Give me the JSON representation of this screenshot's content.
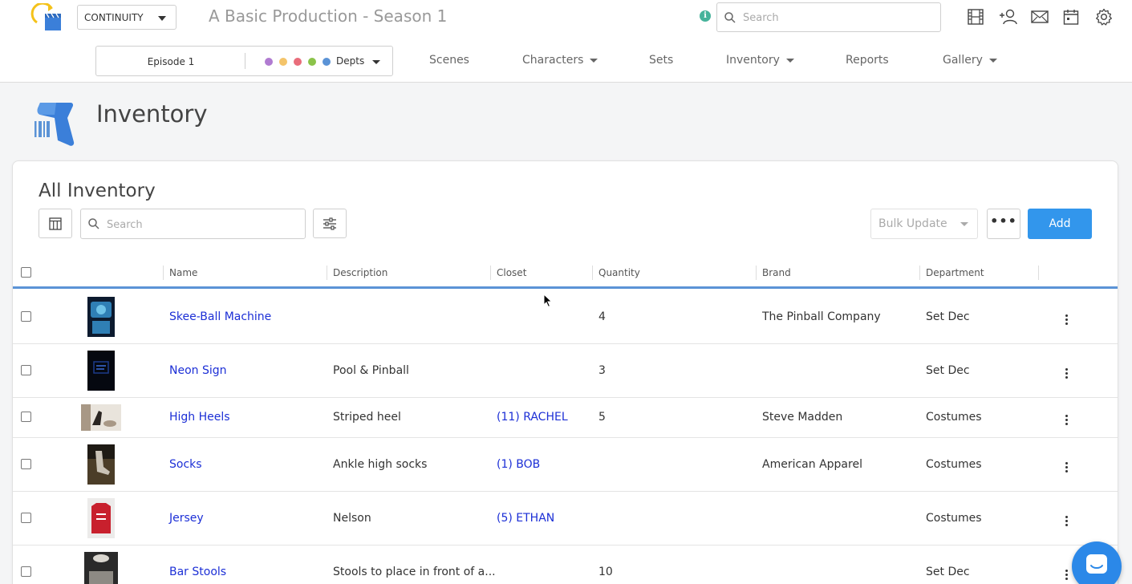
{
  "header": {
    "app_select": "CONTINUITY",
    "production_title": "A Basic Production - Season 1",
    "info_icon": "info-icon",
    "search_placeholder": "Search",
    "icons": [
      "film-icon",
      "add-user-icon",
      "mail-icon",
      "calendar-icon",
      "gear-icon"
    ]
  },
  "subnav": {
    "episode": "Episode 1",
    "dept_colors": [
      "#b07bd1",
      "#f4c46a",
      "#e96d7b",
      "#8bc34a",
      "#5b93d6"
    ],
    "depts_label": "Depts",
    "items": [
      {
        "label": "Scenes",
        "has_caret": false
      },
      {
        "label": "Characters",
        "has_caret": true
      },
      {
        "label": "Sets",
        "has_caret": false
      },
      {
        "label": "Inventory",
        "has_caret": true
      },
      {
        "label": "Reports",
        "has_caret": false
      },
      {
        "label": "Gallery",
        "has_caret": true
      }
    ]
  },
  "page": {
    "title": "Inventory",
    "icon": "barcode-scanner-icon"
  },
  "card": {
    "title": "All Inventory",
    "search_placeholder": "Search",
    "bulk_update_label": "Bulk Update",
    "more_label": "•••",
    "add_label": "Add"
  },
  "table": {
    "columns": [
      "Name",
      "Description",
      "Closet",
      "Quantity",
      "Brand",
      "Department"
    ],
    "rows": [
      {
        "name": "Skee-Ball Machine",
        "description": "",
        "closet": "",
        "quantity": "4",
        "brand": "The Pinball Company",
        "department": "Set Dec",
        "thumb_colors": [
          "#0c1a2e",
          "#2f7fb5",
          "#6fc3e8"
        ]
      },
      {
        "name": "Neon Sign",
        "description": "Pool & Pinball",
        "closet": "",
        "quantity": "3",
        "brand": "",
        "department": "Set Dec",
        "thumb_colors": [
          "#050810",
          "#1d3b8a",
          "#3b6ad6"
        ]
      },
      {
        "name": "High Heels",
        "description": "Striped heel",
        "closet": "(11) RACHEL",
        "quantity": "5",
        "brand": "Steve Madden",
        "department": "Costumes",
        "thumb_colors": [
          "#e9e4dc",
          "#a89886",
          "#2a2522"
        ]
      },
      {
        "name": "Socks",
        "description": "Ankle high socks",
        "closet": "(1) BOB",
        "quantity": "",
        "brand": "American Apparel",
        "department": "Costumes",
        "thumb_colors": [
          "#1e1a14",
          "#4b3d28",
          "#c9c2b6"
        ]
      },
      {
        "name": "Jersey",
        "description": "Nelson",
        "closet": "(5) ETHAN",
        "quantity": "",
        "brand": "",
        "department": "Costumes",
        "thumb_colors": [
          "#ecebea",
          "#c8202d",
          "#ffffff"
        ]
      },
      {
        "name": "Bar Stools",
        "description": "Stools to place in front of a...",
        "closet": "",
        "quantity": "10",
        "brand": "",
        "department": "Set Dec",
        "thumb_colors": [
          "#2a2a2a",
          "#8d8a84",
          "#d9d6cf"
        ]
      }
    ]
  },
  "colors": {
    "accent": "#3296ec",
    "link": "#1c2fd6",
    "header_rule": "#5b93d6"
  }
}
